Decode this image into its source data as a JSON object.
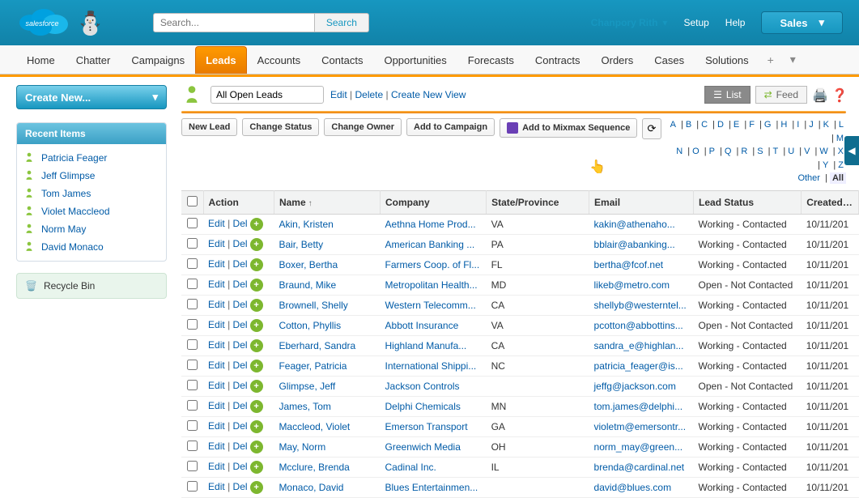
{
  "header": {
    "search_placeholder": "Search...",
    "search_btn": "Search",
    "user_name": "Chanpory Rith",
    "setup": "Setup",
    "help": "Help",
    "app_menu": "Sales"
  },
  "nav": {
    "items": [
      "Home",
      "Chatter",
      "Campaigns",
      "Leads",
      "Accounts",
      "Contacts",
      "Opportunities",
      "Forecasts",
      "Contracts",
      "Orders",
      "Cases",
      "Solutions"
    ],
    "active_index": 3
  },
  "sidebar": {
    "create_new": "Create New...",
    "recent_title": "Recent Items",
    "recent": [
      "Patricia Feager",
      "Jeff Glimpse",
      "Tom James",
      "Violet Maccleod",
      "Norm May",
      "David Monaco"
    ],
    "recycle": "Recycle Bin"
  },
  "main_top": {
    "view": "All Open Leads",
    "edit": "Edit",
    "delete": "Delete",
    "create_view": "Create New View",
    "list": "List",
    "feed": "Feed"
  },
  "actions": {
    "new_lead": "New Lead",
    "change_status": "Change Status",
    "change_owner": "Change Owner",
    "add_campaign": "Add to Campaign",
    "mixmax": "Add to Mixmax Sequence"
  },
  "alpha": {
    "row1": [
      "A",
      "B",
      "C",
      "D",
      "E",
      "F",
      "G",
      "H",
      "I",
      "J",
      "K",
      "L",
      "M"
    ],
    "row2": [
      "N",
      "O",
      "P",
      "Q",
      "R",
      "S",
      "T",
      "U",
      "V",
      "W",
      "X",
      "Y",
      "Z"
    ],
    "other": "Other",
    "all": "All"
  },
  "table": {
    "headers": {
      "action": "Action",
      "name": "Name",
      "company": "Company",
      "state": "State/Province",
      "email": "Email",
      "status": "Lead Status",
      "created": "Created Da"
    },
    "action_labels": {
      "edit": "Edit",
      "del": "Del"
    },
    "rows": [
      {
        "name": "Akin, Kristen",
        "company": "Aethna Home Prod...",
        "state": "VA",
        "email": "kakin@athenaho...",
        "status": "Working - Contacted",
        "created": "10/11/201"
      },
      {
        "name": "Bair, Betty",
        "company": "American Banking ...",
        "state": "PA",
        "email": "bblair@abanking...",
        "status": "Working - Contacted",
        "created": "10/11/201"
      },
      {
        "name": "Boxer, Bertha",
        "company": "Farmers Coop. of Fl...",
        "state": "FL",
        "email": "bertha@fcof.net",
        "status": "Working - Contacted",
        "created": "10/11/201"
      },
      {
        "name": "Braund, Mike",
        "company": "Metropolitan Health...",
        "state": "MD",
        "email": "likeb@metro.com",
        "status": "Open - Not Contacted",
        "created": "10/11/201"
      },
      {
        "name": "Brownell, Shelly",
        "company": "Western Telecomm...",
        "state": "CA",
        "email": "shellyb@westerntel...",
        "status": "Working - Contacted",
        "created": "10/11/201"
      },
      {
        "name": "Cotton, Phyllis",
        "company": "Abbott Insurance",
        "state": "VA",
        "email": "pcotton@abbottins...",
        "status": "Open - Not Contacted",
        "created": "10/11/201"
      },
      {
        "name": "Eberhard, Sandra",
        "company": "Highland Manufa...",
        "state": "CA",
        "email": "sandra_e@highlan...",
        "status": "Working - Contacted",
        "created": "10/11/201"
      },
      {
        "name": "Feager, Patricia",
        "company": "International Shippi...",
        "state": "NC",
        "email": "patricia_feager@is...",
        "status": "Working - Contacted",
        "created": "10/11/201"
      },
      {
        "name": "Glimpse, Jeff",
        "company": "Jackson Controls",
        "state": "",
        "email": "jeffg@jackson.com",
        "status": "Open - Not Contacted",
        "created": "10/11/201"
      },
      {
        "name": "James, Tom",
        "company": "Delphi Chemicals",
        "state": "MN",
        "email": "tom.james@delphi...",
        "status": "Working - Contacted",
        "created": "10/11/201"
      },
      {
        "name": "Maccleod, Violet",
        "company": "Emerson Transport",
        "state": "GA",
        "email": "violetm@emersontr...",
        "status": "Working - Contacted",
        "created": "10/11/201"
      },
      {
        "name": "May, Norm",
        "company": "Greenwich Media",
        "state": "OH",
        "email": "norm_may@green...",
        "status": "Working - Contacted",
        "created": "10/11/201"
      },
      {
        "name": "Mcclure, Brenda",
        "company": "Cadinal Inc.",
        "state": "IL",
        "email": "brenda@cardinal.net",
        "status": "Working - Contacted",
        "created": "10/11/201"
      },
      {
        "name": "Monaco, David",
        "company": "Blues Entertainmen...",
        "state": "",
        "email": "david@blues.com",
        "status": "Working - Contacted",
        "created": "10/11/201"
      }
    ]
  }
}
